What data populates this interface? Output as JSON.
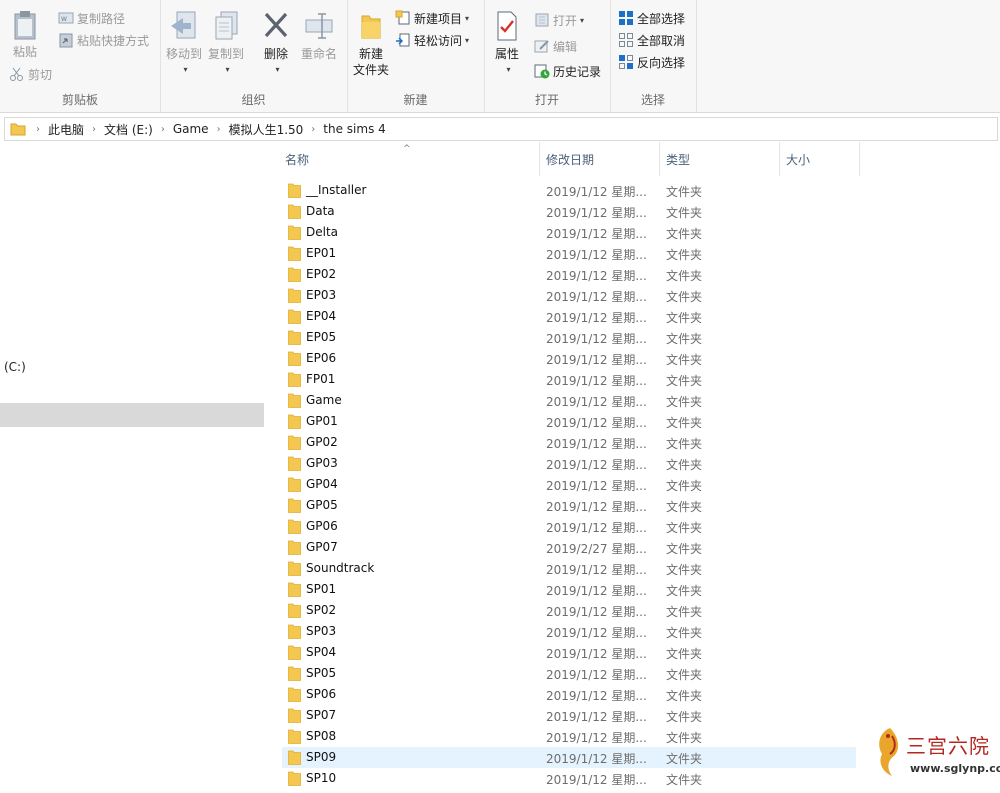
{
  "ribbon": {
    "clipboard": {
      "label": "剪贴板",
      "paste": "粘贴",
      "copy_path": "复制路径",
      "paste_shortcut": "粘贴快捷方式",
      "cut": "剪切"
    },
    "organize": {
      "label": "组织",
      "move_to": "移动到",
      "copy_to": "复制到",
      "delete": "删除",
      "rename": "重命名"
    },
    "new": {
      "label": "新建",
      "new_folder_line1": "新建",
      "new_folder_line2": "文件夹",
      "new_item": "新建项目",
      "easy_access": "轻松访问"
    },
    "open": {
      "label": "打开",
      "properties": "属性",
      "open": "打开",
      "edit": "编辑",
      "history": "历史记录"
    },
    "select": {
      "label": "选择",
      "select_all": "全部选择",
      "select_none": "全部取消",
      "invert": "反向选择"
    }
  },
  "breadcrumb": [
    "此电脑",
    "文档 (E:)",
    "Game",
    "模拟人生1.50",
    "the sims 4"
  ],
  "nav": {
    "drive_label": "(C:)"
  },
  "columns": {
    "name": "名称",
    "date": "修改日期",
    "type": "类型",
    "size": "大小"
  },
  "files": [
    {
      "name": "__Installer",
      "date": "2019/1/12 星期...",
      "type": "文件夹"
    },
    {
      "name": "Data",
      "date": "2019/1/12 星期...",
      "type": "文件夹"
    },
    {
      "name": "Delta",
      "date": "2019/1/12 星期...",
      "type": "文件夹"
    },
    {
      "name": "EP01",
      "date": "2019/1/12 星期...",
      "type": "文件夹"
    },
    {
      "name": "EP02",
      "date": "2019/1/12 星期...",
      "type": "文件夹"
    },
    {
      "name": "EP03",
      "date": "2019/1/12 星期...",
      "type": "文件夹"
    },
    {
      "name": "EP04",
      "date": "2019/1/12 星期...",
      "type": "文件夹"
    },
    {
      "name": "EP05",
      "date": "2019/1/12 星期...",
      "type": "文件夹"
    },
    {
      "name": "EP06",
      "date": "2019/1/12 星期...",
      "type": "文件夹"
    },
    {
      "name": "FP01",
      "date": "2019/1/12 星期...",
      "type": "文件夹"
    },
    {
      "name": "Game",
      "date": "2019/1/12 星期...",
      "type": "文件夹"
    },
    {
      "name": "GP01",
      "date": "2019/1/12 星期...",
      "type": "文件夹"
    },
    {
      "name": "GP02",
      "date": "2019/1/12 星期...",
      "type": "文件夹"
    },
    {
      "name": "GP03",
      "date": "2019/1/12 星期...",
      "type": "文件夹"
    },
    {
      "name": "GP04",
      "date": "2019/1/12 星期...",
      "type": "文件夹"
    },
    {
      "name": "GP05",
      "date": "2019/1/12 星期...",
      "type": "文件夹"
    },
    {
      "name": "GP06",
      "date": "2019/1/12 星期...",
      "type": "文件夹"
    },
    {
      "name": "GP07",
      "date": "2019/2/27 星期...",
      "type": "文件夹"
    },
    {
      "name": "Soundtrack",
      "date": "2019/1/12 星期...",
      "type": "文件夹"
    },
    {
      "name": "SP01",
      "date": "2019/1/12 星期...",
      "type": "文件夹"
    },
    {
      "name": "SP02",
      "date": "2019/1/12 星期...",
      "type": "文件夹"
    },
    {
      "name": "SP03",
      "date": "2019/1/12 星期...",
      "type": "文件夹"
    },
    {
      "name": "SP04",
      "date": "2019/1/12 星期...",
      "type": "文件夹"
    },
    {
      "name": "SP05",
      "date": "2019/1/12 星期...",
      "type": "文件夹"
    },
    {
      "name": "SP06",
      "date": "2019/1/12 星期...",
      "type": "文件夹"
    },
    {
      "name": "SP07",
      "date": "2019/1/12 星期...",
      "type": "文件夹"
    },
    {
      "name": "SP08",
      "date": "2019/1/12 星期...",
      "type": "文件夹"
    },
    {
      "name": "SP09",
      "date": "2019/1/12 星期...",
      "type": "文件夹",
      "hovered": true
    },
    {
      "name": "SP10",
      "date": "2019/1/12 星期...",
      "type": "文件夹"
    }
  ],
  "watermark": {
    "title": "三宫六院",
    "url": "www.sglynp.com"
  },
  "colors": {
    "folder": "#f3c750",
    "folder_tab": "#e3ad2c",
    "hover_row": "#e5f3ff",
    "accent_blue": "#1e6fc8"
  }
}
